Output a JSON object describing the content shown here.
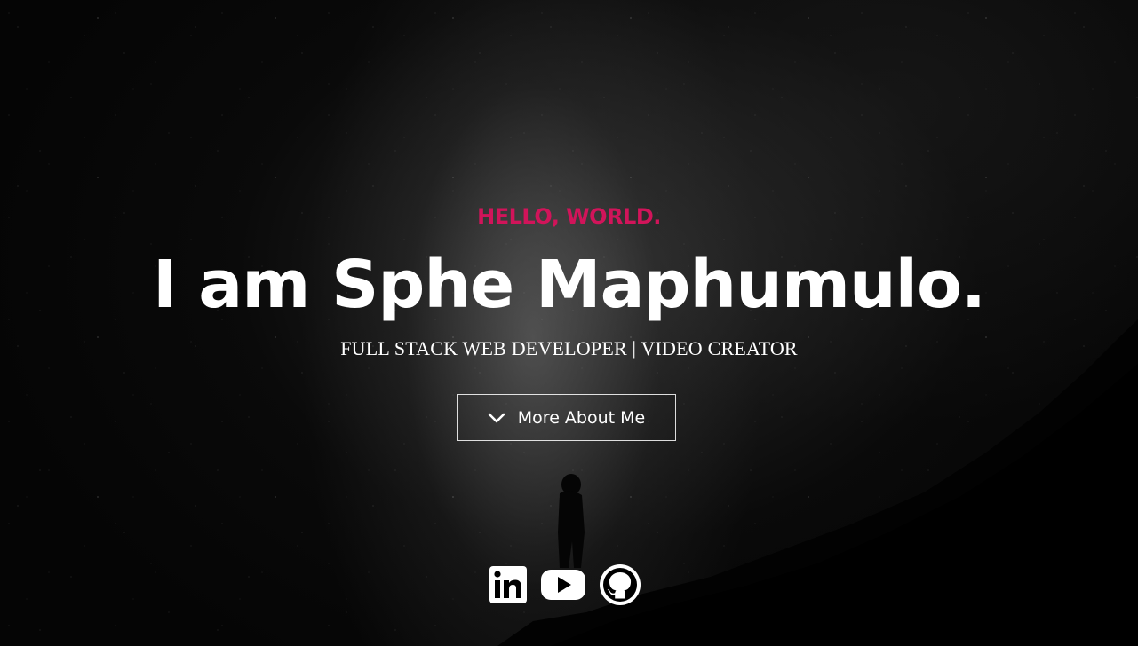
{
  "hero": {
    "kicker": "HELLO, WORLD.",
    "title": "I am Sphe Maphumulo.",
    "subtitle": "FULL STACK WEB DEVELOPER | VIDEO CREATOR",
    "more_button": {
      "label": "More About Me",
      "icon": "chevron-down-icon"
    },
    "accent_color": "#d1145a"
  },
  "socials": [
    {
      "icon": "linkedin-icon"
    },
    {
      "icon": "youtube-icon"
    },
    {
      "icon": "github-icon"
    }
  ]
}
